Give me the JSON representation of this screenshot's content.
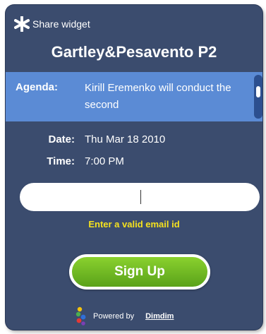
{
  "widget": {
    "share_label": "Share widget",
    "title": "Gartley&Pesavento P2",
    "agenda": {
      "label": "Agenda:",
      "text": "Kirill Eremenko will conduct the second"
    },
    "date": {
      "label": "Date:",
      "value": "Thu Mar 18 2010"
    },
    "time": {
      "label": "Time:",
      "value": "7:00 PM"
    },
    "email": {
      "value": "",
      "placeholder": ""
    },
    "error_message": "Enter a valid email id",
    "signup_label": "Sign Up",
    "powered_by": "Powered by",
    "brand_link": "Dimdim"
  },
  "colors": {
    "panel_bg": "#3b4c6e",
    "agenda_bg": "#5b8bd5",
    "error_text": "#f6e21e",
    "button_green": "#6fbf1f"
  },
  "icons": {
    "share": "star-icon",
    "brand": "dimdim-logo-icon"
  }
}
